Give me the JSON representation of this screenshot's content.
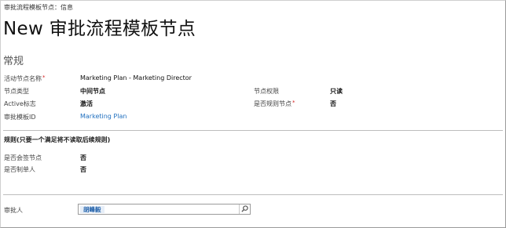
{
  "breadcrumb": "审批流程模板节点：信息",
  "title": "New 审批流程模板节点",
  "section": {
    "title": "常规",
    "fields": {
      "node_name": {
        "label": "活动节点名称",
        "value": "Marketing Plan - Marketing Director",
        "required": "*"
      },
      "node_type": {
        "label": "节点类型",
        "value": "中间节点"
      },
      "node_permission": {
        "label": "节点权限",
        "value": "只读"
      },
      "active_flag": {
        "label": "Active标志",
        "value": "激活"
      },
      "is_rule_node": {
        "label": "是否规则节点",
        "value": "否",
        "required": "*"
      },
      "template_id": {
        "label": "审批模板ID",
        "value": "Marketing Plan"
      }
    }
  },
  "rules": {
    "heading": "规则(只要一个满足将不读取后续规则)",
    "fields": {
      "countersign": {
        "label": "是否会签节点",
        "value": "否"
      },
      "creator": {
        "label": "是否制单人",
        "value": "否"
      }
    }
  },
  "approver": {
    "label": "审批人",
    "value": "胡峰毅",
    "search_icon": "search-icon"
  }
}
